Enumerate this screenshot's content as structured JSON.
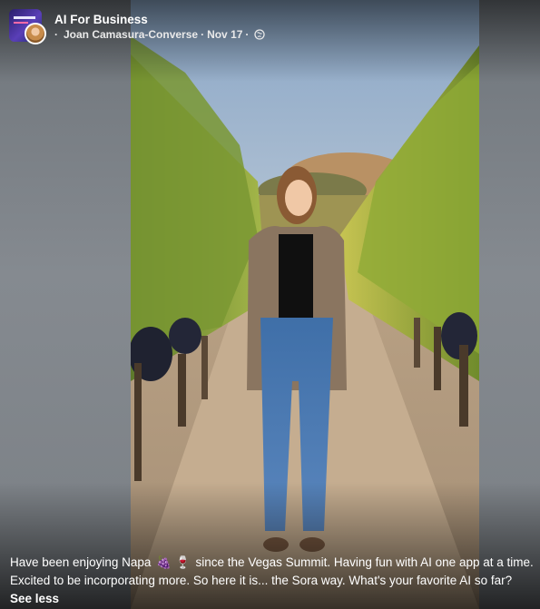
{
  "post": {
    "group_name": "AI For Business",
    "author": "Joan Camasura-Converse",
    "date": "Nov 17",
    "separator": "·",
    "privacy_icon": "globe-icon"
  },
  "caption": {
    "text_before_emoji": "Have been enjoying Napa",
    "emoji_1": "🍇",
    "emoji_2": "🍷",
    "text_after_emoji": "since the Vegas Summit. Having fun with AI one app at a time. Excited to be incorporating more. So here it is... the Sora way. What's your favorite AI so far?",
    "see_less_label": "See less"
  },
  "colors": {
    "text": "#ffffff",
    "backdrop": "#7e8389",
    "group_avatar_bg": "#3a2a8a"
  }
}
